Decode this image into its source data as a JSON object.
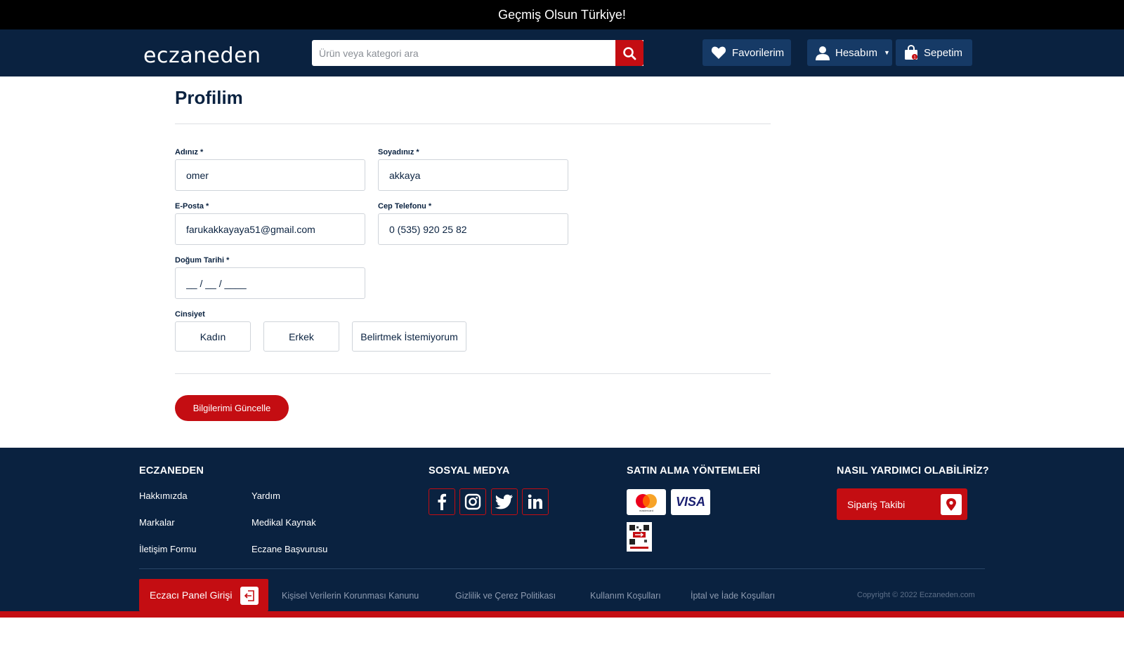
{
  "topbar": {
    "message": "Geçmiş Olsun Türkiye!"
  },
  "header": {
    "logo": "eczaneden",
    "search_placeholder": "Ürün veya kategori ara",
    "favorites_label": "Favorilerim",
    "account_label": "Hesabım",
    "cart_label": "Sepetim",
    "cart_count": "1"
  },
  "profile": {
    "title": "Profilim",
    "first_name": {
      "label": "Adınız *",
      "value": "omer"
    },
    "last_name": {
      "label": "Soyadınız *",
      "value": "akkaya"
    },
    "email": {
      "label": "E-Posta *",
      "value": "farukakkayaya51@gmail.com"
    },
    "phone": {
      "label": "Cep Telefonu *",
      "value": "0 (535) 920 25 82"
    },
    "birthdate": {
      "label": "Doğum Tarihi *",
      "placeholder": "__ / __ / ____"
    },
    "gender": {
      "label": "Cinsiyet",
      "options": [
        "Kadın",
        "Erkek",
        "Belirtmek İstemiyorum"
      ]
    },
    "submit_label": "Bilgilerimi Güncelle"
  },
  "footer": {
    "col1": {
      "heading": "ECZANEDEN",
      "links": [
        "Hakkımızda",
        "Yardım",
        "Markalar",
        "Medikal Kaynak",
        "İletişim Formu",
        "Eczane Başvurusu"
      ]
    },
    "col2": {
      "heading": "SOSYAL MEDYA",
      "icons": [
        "facebook-icon",
        "instagram-icon",
        "twitter-icon",
        "linkedin-icon"
      ]
    },
    "col3": {
      "heading": "SATIN ALMA YÖNTEMLERİ",
      "methods": [
        "mastercard",
        "VISA"
      ]
    },
    "col4": {
      "heading": "NASIL YARDIMCI OLABİLİRİZ?",
      "track_label": "Sipariş Takibi"
    },
    "panel_label": "Eczacı Panel Girişi",
    "bottom_links": [
      "Kişisel Verilerin Korunması Kanunu",
      "Gizlilik ve Çerez Politikası",
      "Kullanım Koşulları",
      "İptal ve İade Koşulları"
    ],
    "copyright": "Copyright © 2022 Eczaneden.com"
  },
  "colors": {
    "navy": "#0a2240",
    "red": "#c40d12",
    "button_blue": "#163a66"
  }
}
